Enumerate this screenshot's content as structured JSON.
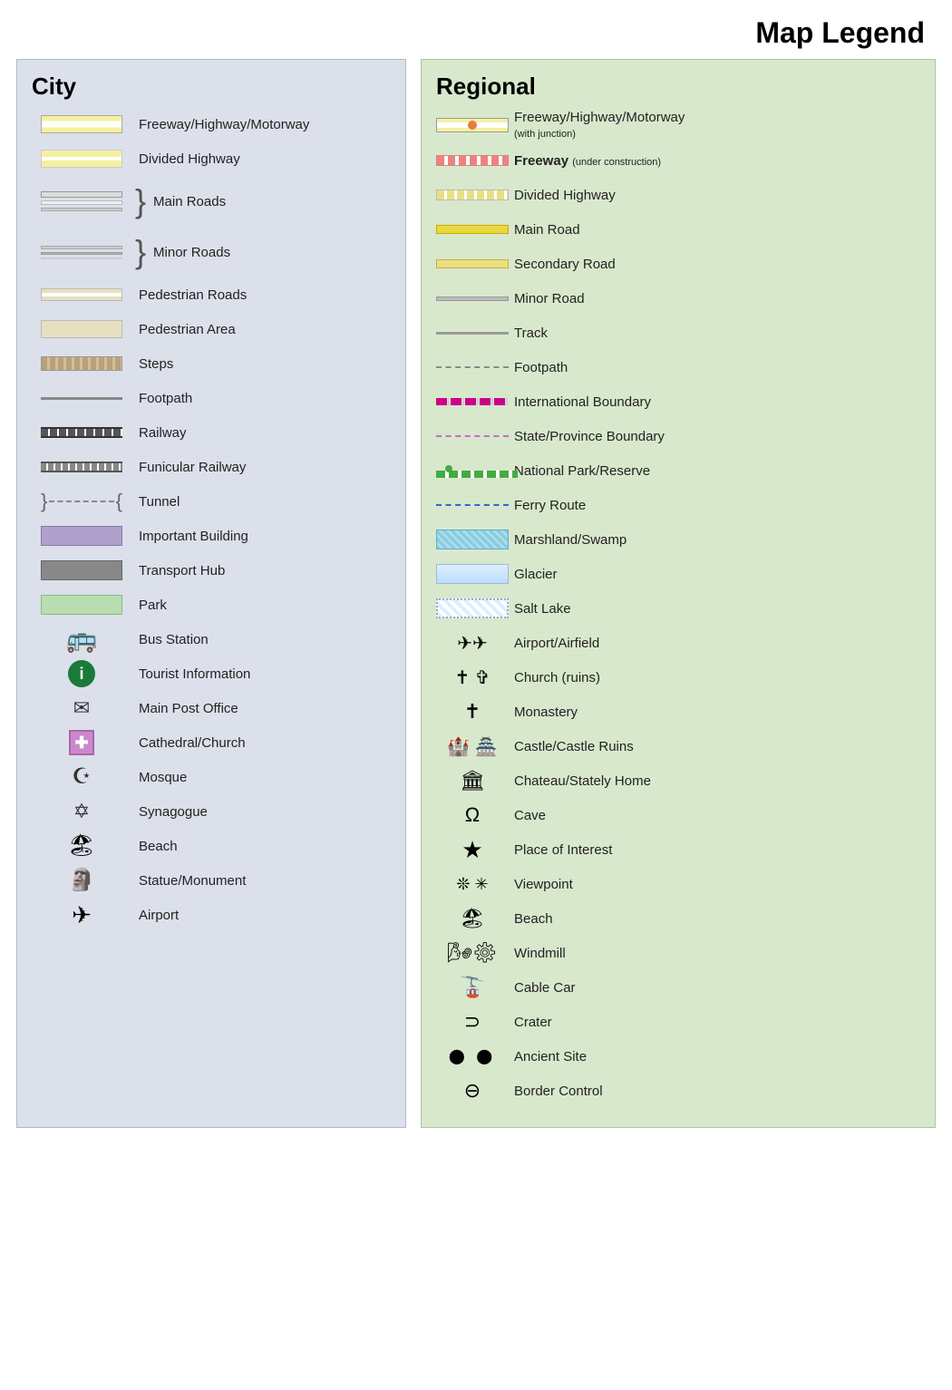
{
  "title": "Map Legend",
  "city": {
    "title": "City",
    "items": [
      {
        "id": "freeway",
        "label": "Freeway/Highway/Motorway",
        "type": "road-freeway"
      },
      {
        "id": "divided-hwy",
        "label": "Divided Highway",
        "type": "road-divided"
      },
      {
        "id": "main-roads",
        "label": "Main Roads",
        "type": "brace-main"
      },
      {
        "id": "minor-roads",
        "label": "Minor Roads",
        "type": "brace-minor"
      },
      {
        "id": "pedestrian-roads",
        "label": "Pedestrian Roads",
        "type": "road-pedestrian"
      },
      {
        "id": "pedestrian-area",
        "label": "Pedestrian Area",
        "type": "road-ped-area"
      },
      {
        "id": "steps",
        "label": "Steps",
        "type": "road-steps"
      },
      {
        "id": "footpath",
        "label": "Footpath",
        "type": "road-footpath"
      },
      {
        "id": "railway",
        "label": "Railway",
        "type": "road-railway"
      },
      {
        "id": "funicular",
        "label": "Funicular Railway",
        "type": "road-funicular"
      },
      {
        "id": "tunnel",
        "label": "Tunnel",
        "type": "road-tunnel"
      },
      {
        "id": "important-building",
        "label": "Important Building",
        "type": "building-important"
      },
      {
        "id": "transport-hub",
        "label": "Transport Hub",
        "type": "transport-hub"
      },
      {
        "id": "park",
        "label": "Park",
        "type": "park-box"
      },
      {
        "id": "bus-station",
        "label": "Bus Station",
        "type": "sym-bus"
      },
      {
        "id": "tourist-info",
        "label": "Tourist Information",
        "type": "sym-info"
      },
      {
        "id": "main-post",
        "label": "Main Post Office",
        "type": "sym-mail"
      },
      {
        "id": "cathedral",
        "label": "Cathedral/Church",
        "type": "sym-cross"
      },
      {
        "id": "mosque",
        "label": "Mosque",
        "type": "sym-mosque"
      },
      {
        "id": "synagogue",
        "label": "Synagogue",
        "type": "sym-star6"
      },
      {
        "id": "beach",
        "label": "Beach",
        "type": "sym-beach"
      },
      {
        "id": "statue",
        "label": "Statue/Monument",
        "type": "sym-statue"
      },
      {
        "id": "airport",
        "label": "Airport",
        "type": "sym-airport"
      }
    ]
  },
  "regional": {
    "title": "Regional",
    "items": [
      {
        "id": "reg-freeway",
        "label": "Freeway/Highway/Motorway",
        "sublabel": "(with junction)",
        "type": "reg-freeway"
      },
      {
        "id": "reg-freeway-const",
        "label": "Freeway",
        "sublabel": "(under construction)",
        "type": "reg-freeway-construction"
      },
      {
        "id": "reg-divided",
        "label": "Divided Highway",
        "type": "reg-divided"
      },
      {
        "id": "reg-main-road",
        "label": "Main Road",
        "type": "reg-main-road"
      },
      {
        "id": "reg-secondary",
        "label": "Secondary Road",
        "type": "reg-secondary"
      },
      {
        "id": "reg-minor",
        "label": "Minor Road",
        "type": "reg-minor"
      },
      {
        "id": "reg-track",
        "label": "Track",
        "type": "reg-track"
      },
      {
        "id": "reg-footpath",
        "label": "Footpath",
        "type": "reg-footpath"
      },
      {
        "id": "reg-intl-boundary",
        "label": "International Boundary",
        "type": "reg-intl-boundary"
      },
      {
        "id": "reg-state-boundary",
        "label": "State/Province Boundary",
        "type": "reg-state-boundary"
      },
      {
        "id": "reg-natpark",
        "label": "National Park/Reserve",
        "type": "reg-natpark"
      },
      {
        "id": "reg-ferry",
        "label": "Ferry Route",
        "type": "reg-ferry"
      },
      {
        "id": "reg-marsh",
        "label": "Marshland/Swamp",
        "type": "reg-marsh"
      },
      {
        "id": "reg-glacier",
        "label": "Glacier",
        "type": "reg-glacier"
      },
      {
        "id": "reg-salt-lake",
        "label": "Salt Lake",
        "type": "reg-salt-lake"
      },
      {
        "id": "airport-airfield",
        "label": "Airport/Airfield",
        "type": "sym-airport2"
      },
      {
        "id": "church-ruins",
        "label": "Church (ruins)",
        "type": "sym-church-ruins"
      },
      {
        "id": "monastery",
        "label": "Monastery",
        "type": "sym-monastery"
      },
      {
        "id": "castle",
        "label": "Castle/Castle Ruins",
        "type": "sym-castle"
      },
      {
        "id": "chateau",
        "label": "Chateau/Stately Home",
        "type": "sym-chateau"
      },
      {
        "id": "cave",
        "label": "Cave",
        "type": "sym-cave"
      },
      {
        "id": "place-interest",
        "label": "Place of Interest",
        "type": "sym-star"
      },
      {
        "id": "viewpoint",
        "label": "Viewpoint",
        "type": "sym-viewpoint"
      },
      {
        "id": "beach-reg",
        "label": "Beach",
        "type": "sym-beach2"
      },
      {
        "id": "windmill",
        "label": "Windmill",
        "type": "sym-windmill"
      },
      {
        "id": "cable-car",
        "label": "Cable Car",
        "type": "sym-cablecar"
      },
      {
        "id": "crater",
        "label": "Crater",
        "type": "sym-crater"
      },
      {
        "id": "ancient-site",
        "label": "Ancient Site",
        "type": "sym-ancient"
      },
      {
        "id": "border-control",
        "label": "Border Control",
        "type": "sym-border"
      }
    ]
  }
}
